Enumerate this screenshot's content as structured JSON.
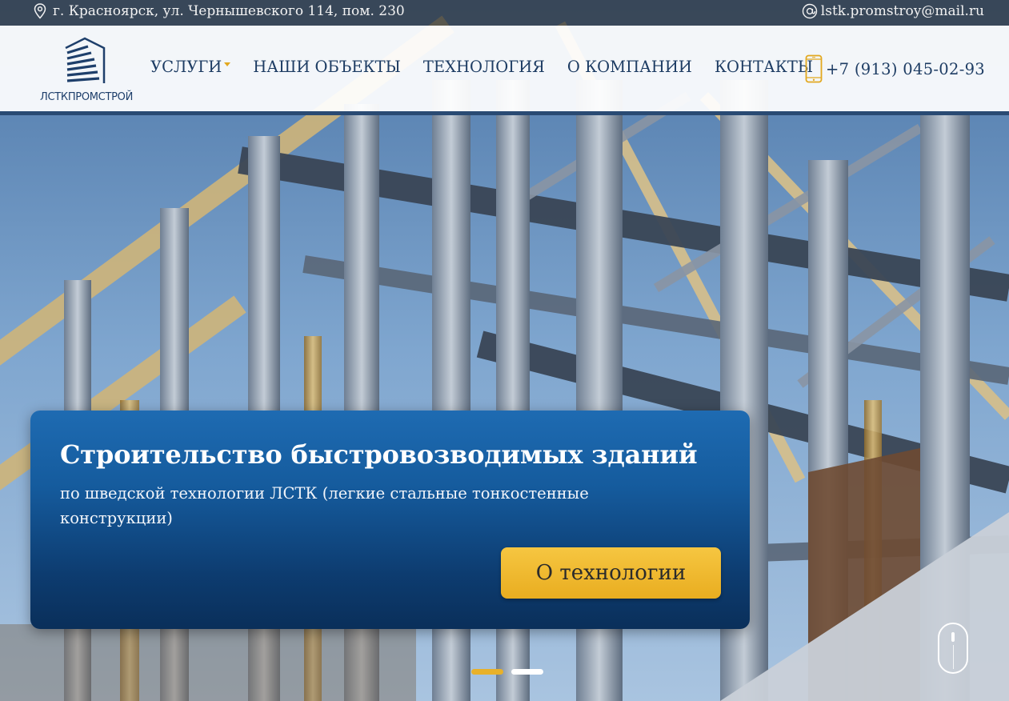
{
  "topbar": {
    "address": "г. Красноярск, ул. Чернышевского 114, пом. 230",
    "email": "lstk.promstroy@mail.ru"
  },
  "header": {
    "logo_text": "ЛСТКПРОМСТРОЙ",
    "nav": [
      {
        "label": "УСЛУГИ",
        "has_dropdown": true
      },
      {
        "label": "НАШИ ОБЪЕКТЫ"
      },
      {
        "label": "ТЕХНОЛОГИЯ"
      },
      {
        "label": "О КОМПАНИИ"
      },
      {
        "label": "КОНТАКТЫ"
      }
    ],
    "phone": "+7 (913) 045-02-93"
  },
  "hero": {
    "title": "Строительство быстровозводимых зданий",
    "subtitle": "по шведской технологии ЛСТК (легкие стальные тонкостенные конструкции)",
    "button_label": "О технологии",
    "slides_total": 2,
    "active_slide": 1
  },
  "colors": {
    "brand_dark": "#1d3c63",
    "accent_gold": "#e8b12a",
    "card_blue": "#155b9d"
  }
}
